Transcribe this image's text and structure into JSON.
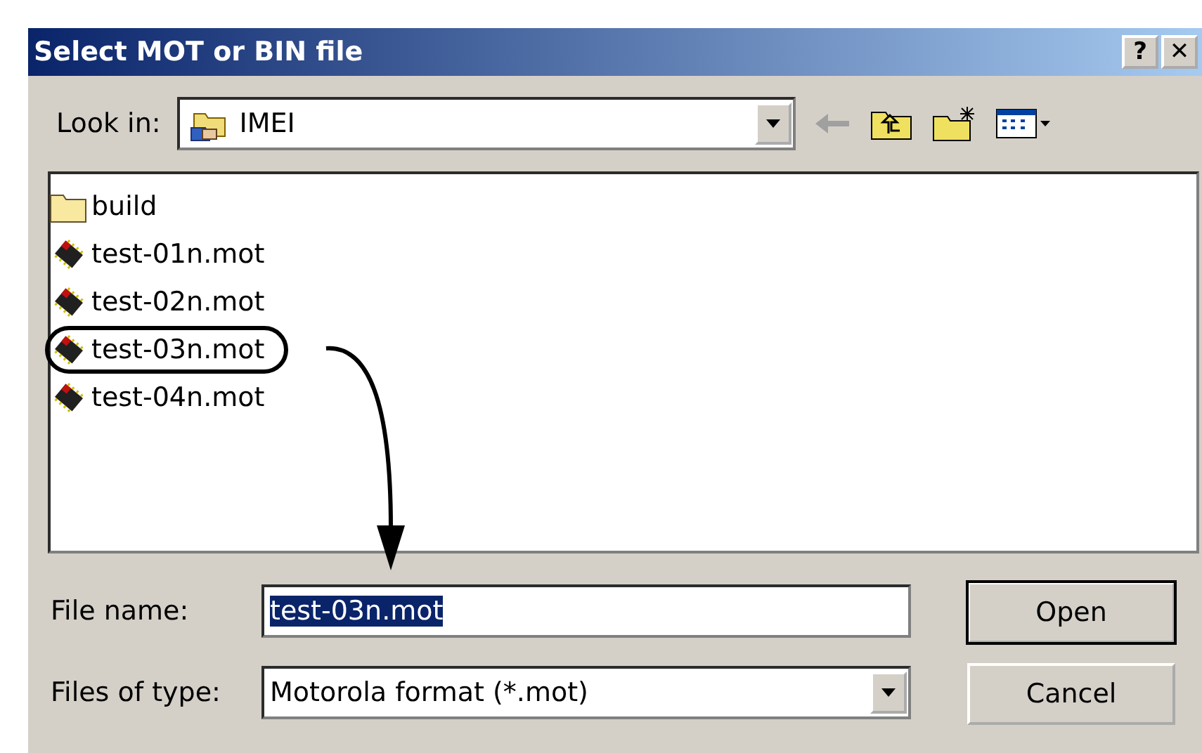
{
  "window": {
    "title": "Select MOT or BIN file",
    "buttons": [
      "?",
      "✕"
    ]
  },
  "look_in": {
    "label": "Look in:",
    "value": "IMEI"
  },
  "files": [
    {
      "kind": "folder",
      "name": "build",
      "circled": false
    },
    {
      "kind": "file",
      "name": "test-01n.mot",
      "circled": false
    },
    {
      "kind": "file",
      "name": "test-02n.mot",
      "circled": false
    },
    {
      "kind": "file",
      "name": "test-03n.mot",
      "circled": true
    },
    {
      "kind": "file",
      "name": "test-04n.mot",
      "circled": false
    }
  ],
  "file_name": {
    "label": "File name:",
    "value": "test-03n.mot",
    "text_selected": true
  },
  "files_of_type": {
    "label": "Files of type:",
    "value": "Motorola format (*.mot)"
  },
  "buttons": [
    {
      "label": "Open",
      "default": true
    },
    {
      "label": "Cancel",
      "default": false
    }
  ]
}
